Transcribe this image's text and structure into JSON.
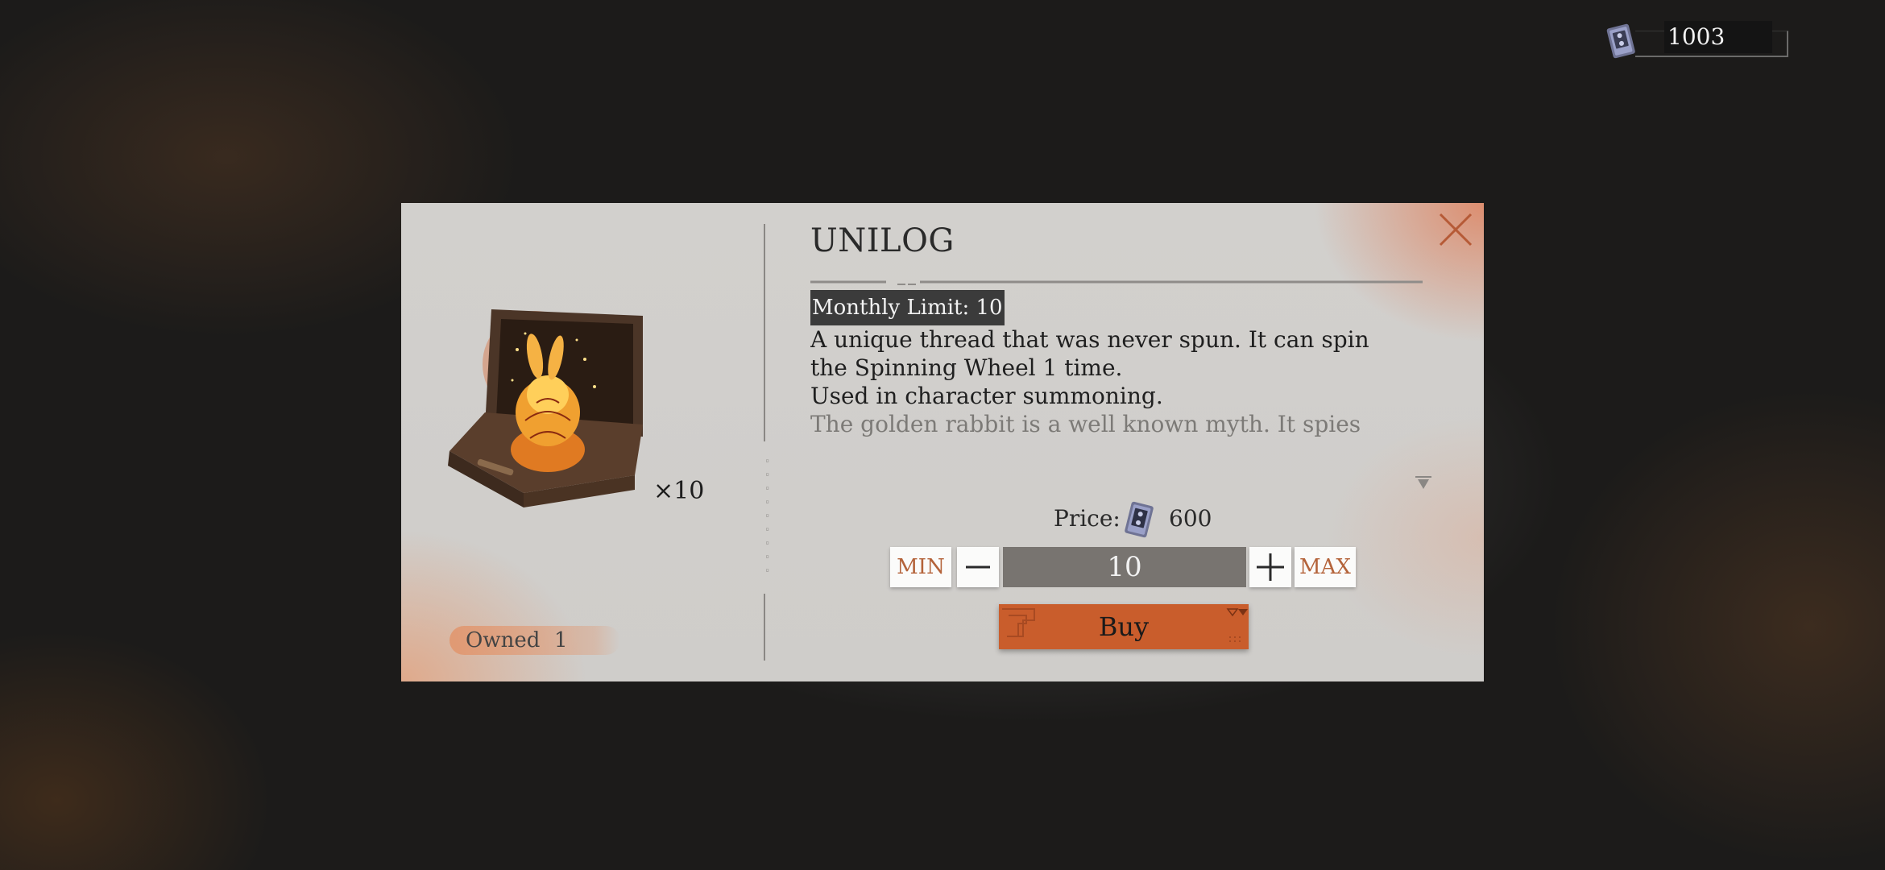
{
  "currency": {
    "icon": "cassette-tape-icon",
    "value": "1003"
  },
  "dialog": {
    "title": "UNILOG",
    "close_icon": "close-icon",
    "item": {
      "image": "golden-rabbit-in-box",
      "quantity_badge": "×10",
      "owned_label": "Owned",
      "owned_value": "1"
    },
    "monthly_limit": "Monthly Limit: 10",
    "description": {
      "line1": "A unique thread that was never spun. It can spin the Spinning Wheel 1 time.",
      "line2": "Used in character summoning.",
      "lore": "The golden rabbit is a well known myth. It spies on people, steals their time, and sometimes even changes their fates. Though it's old, decrepit, and stale, it is"
    },
    "price": {
      "label": "Price:",
      "icon": "cassette-tape-icon",
      "value": "600"
    },
    "quantity": {
      "min_label": "MIN",
      "max_label": "MAX",
      "value": "10",
      "minus_icon": "minus-icon",
      "plus_icon": "plus-icon"
    },
    "buy_label": "Buy"
  },
  "colors": {
    "accent": "#c95d2c",
    "accent_text": "#b4633a",
    "modal_bg": "#d0cecb",
    "quantity_field": "#787470",
    "limit_badge": "#3b3b3b"
  }
}
